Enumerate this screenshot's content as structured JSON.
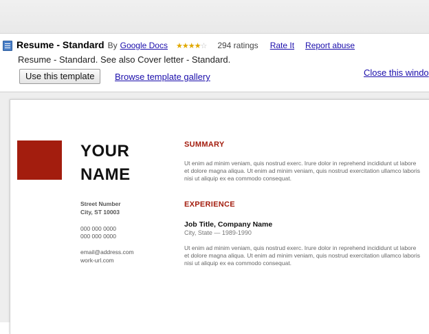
{
  "template": {
    "title": "Resume - Standard",
    "by_label": "By",
    "author": "Google Docs",
    "stars_filled": "★★★★",
    "stars_empty": "☆",
    "rating_value": 4,
    "ratings_text": "294 ratings",
    "rate_label": "Rate It",
    "report_label": "Report abuse",
    "description": "Resume - Standard. See also Cover letter - Standard."
  },
  "actions": {
    "use_template": "Use this template",
    "browse_gallery": "Browse template gallery",
    "close_window": "Close this windo"
  },
  "preview": {
    "name": "YOUR\nNAME",
    "address_line1": "Street Number",
    "address_line2": "City, ST 10003",
    "phone1": "000 000 0000",
    "phone2": "000 000 0000",
    "email": "email@address.com",
    "url": "work-url.com",
    "summary_heading": "SUMMARY",
    "summary_text": "Ut enim ad minim veniam, quis nostrud exerc. Irure dolor in reprehend incididunt ut labore et dolore magna aliqua. Ut enim ad minim veniam, quis nostrud exercitation ullamco laboris nisi ut aliquip ex ea commodo consequat.",
    "experience_heading": "EXPERIENCE",
    "job_title": "Job Title, Company Name",
    "job_meta": "City, State — 1989-1990",
    "job_text": "Ut enim ad minim veniam, quis nostrud exerc. Irure dolor in reprehend incididunt ut labore et dolore magna aliqua. Ut enim ad minim veniam, quis nostrud exercitation ullamco laboris nisi ut aliquip ex ea commodo consequat."
  },
  "colors": {
    "accent_red": "#a31d0e",
    "link_blue": "#1a0dab",
    "star_gold": "#e0a800"
  },
  "icons": {
    "doc_icon": "google-docs-document-icon"
  }
}
